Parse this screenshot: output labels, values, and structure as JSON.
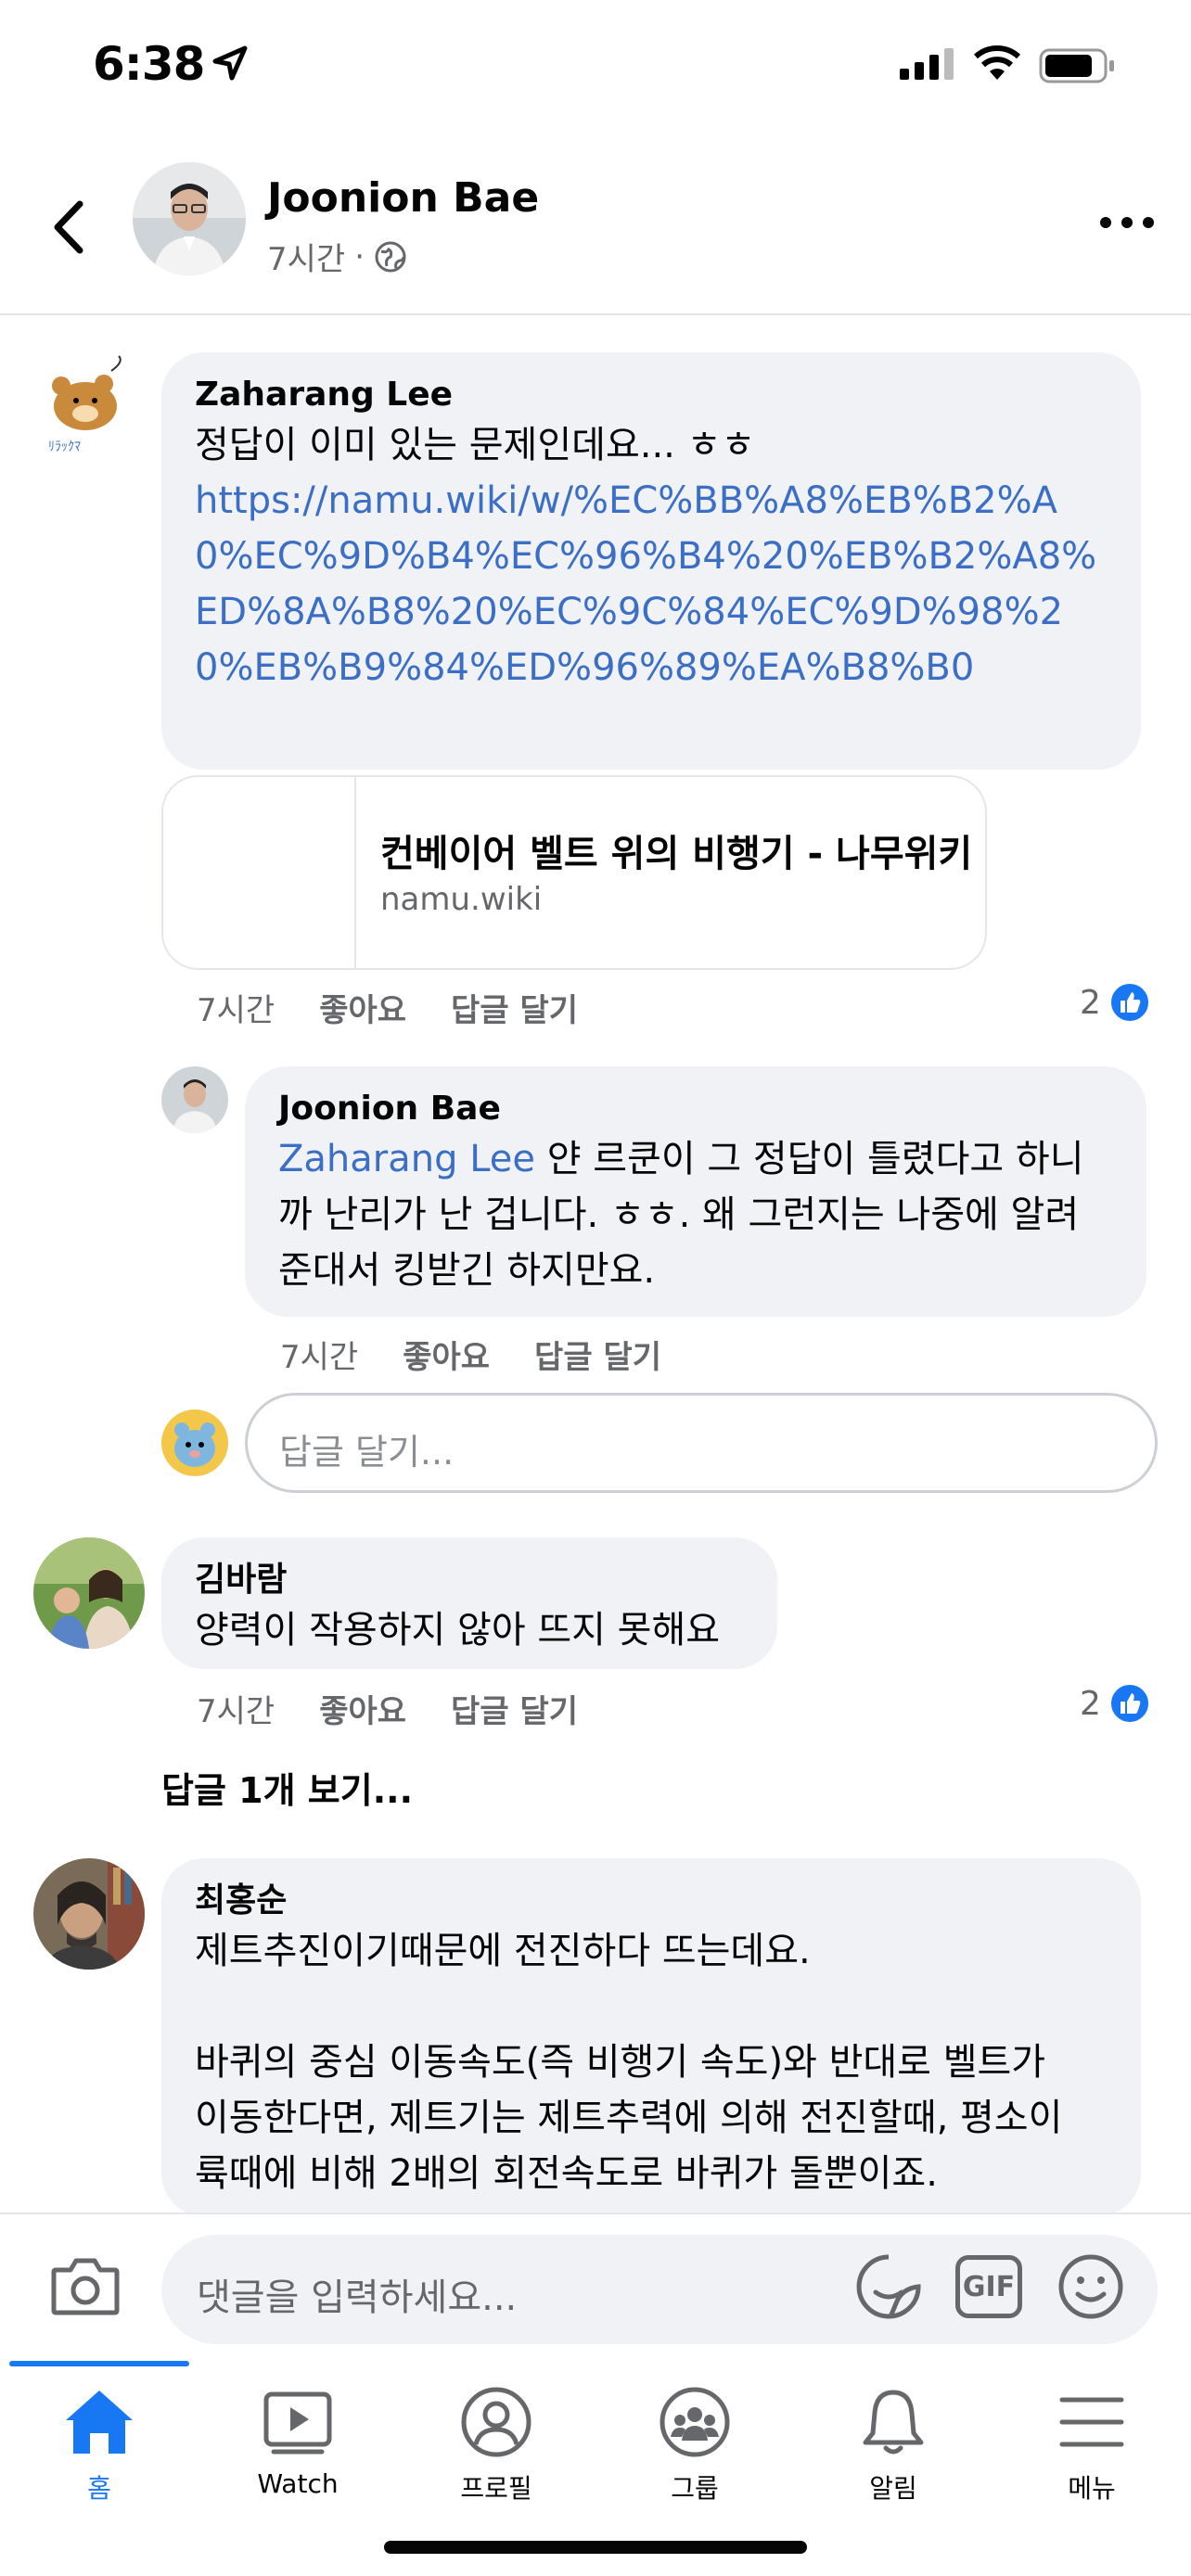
{
  "status_bar": {
    "time": "6:38"
  },
  "header": {
    "name": "Joonion Bae",
    "time": "7시간",
    "separator": "·"
  },
  "comments": [
    {
      "author": "Zaharang Lee",
      "text": "정답이 이미 있는 문제인데요... ㅎㅎ",
      "link": "https://namu.wiki/w/%EC%BB%A8%EB%B2%A0%EC%9D%B4%EC%96%B4%20%EB%B2%A8%ED%8A%B8%20%EC%9C%84%EC%9D%98%20%EB%B9%84%ED%96%89%EA%B8%B0",
      "preview": {
        "title": "컨베이어 벨트 위의 비행기 - 나무위키",
        "domain": "namu.wiki"
      },
      "time": "7시간",
      "like": "좋아요",
      "reply": "답글 달기",
      "reactions": "2"
    },
    {
      "author": "Joonion Bae",
      "mention": "Zaharang Lee",
      "text_line1": " 얀 르쿤이 그 정답이 틀렸다고 하니",
      "text_line2": "까 난리가 난 겁니다. ㅎㅎ. 왜 그런지는 나중에 알려",
      "text_line3": "준대서 킹받긴 하지만요.",
      "time": "7시간",
      "like": "좋아요",
      "reply": "답글 달기"
    },
    {
      "author": "김바람",
      "text": "양력이 작용하지 않아 뜨지 못해요",
      "time": "7시간",
      "like": "좋아요",
      "reply": "답글 달기",
      "reactions": "2"
    },
    {
      "author": "최홍순",
      "text_line1": "제트추진이기때문에 전진하다 뜨는데요.",
      "text_line2": "바퀴의 중심 이동속도(즉 비행기 속도)와 반대로 벨트가",
      "text_line3": "이동한다면, 제트기는 제트추력에 의해 전진할때, 평소이",
      "text_line4": "륙때에 비해 2배의 회전속도로 바퀴가 돌뿐이죠."
    }
  ],
  "reply_placeholder": "답글 달기...",
  "view_replies": "답글 1개 보기...",
  "composer": {
    "placeholder": "댓글을 입력하세요...",
    "gif": "GIF"
  },
  "tabs": [
    {
      "label": "홈",
      "icon": "home-icon"
    },
    {
      "label": "Watch",
      "icon": "watch-icon"
    },
    {
      "label": "프로필",
      "icon": "profile-icon"
    },
    {
      "label": "그룹",
      "icon": "groups-icon"
    },
    {
      "label": "알림",
      "icon": "bell-icon"
    },
    {
      "label": "메뉴",
      "icon": "menu-icon"
    }
  ],
  "colors": {
    "accent": "#1877f2",
    "link": "#3b6fc6",
    "bubble": "#f0f2f5",
    "muted": "#65676b"
  }
}
